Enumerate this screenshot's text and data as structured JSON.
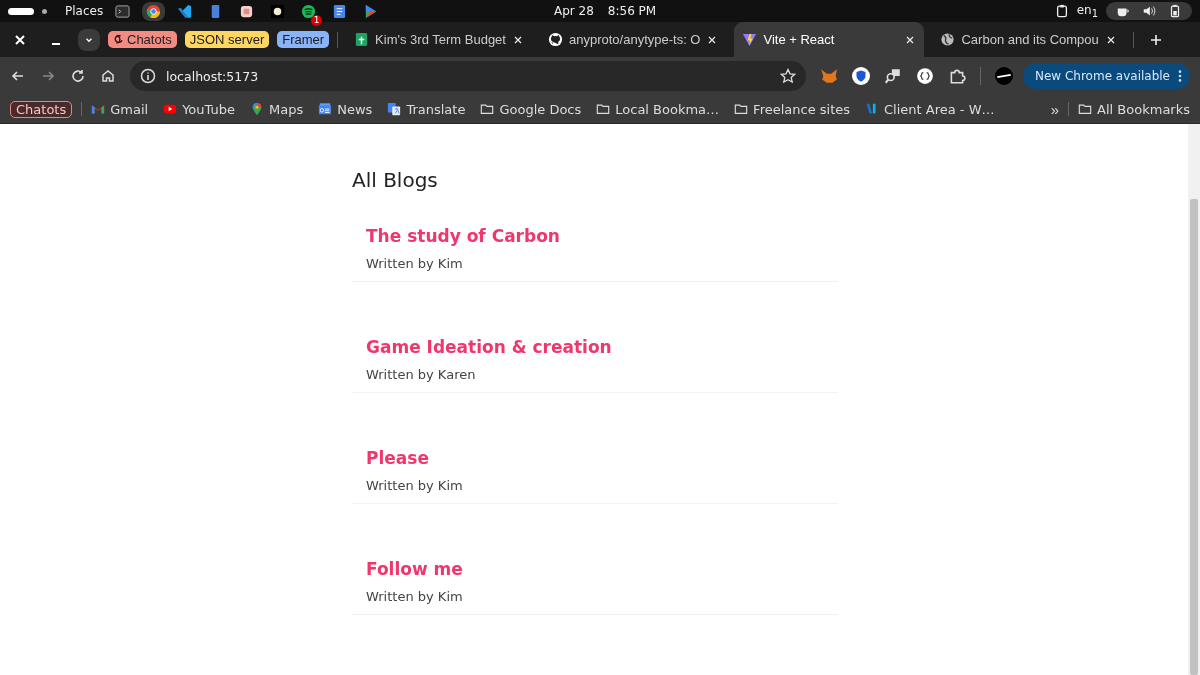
{
  "system_bar": {
    "places": "Places",
    "date": "Apr 28",
    "time": "8:56 PM",
    "keyboard": "en$_{1}$",
    "notification_count": "1"
  },
  "tab_groups": [
    {
      "label": "Chatots",
      "color": "#f28b82",
      "icon": true
    },
    {
      "label": "JSON server",
      "color": "#fdd663",
      "icon": false
    },
    {
      "label": "Framer",
      "color": "#8ab4f8",
      "icon": false
    }
  ],
  "tabs": [
    {
      "title": "Kim's 3rd Term Budget",
      "selected": false,
      "kind": "sheet"
    },
    {
      "title": "anyproto/anytype-ts: O",
      "selected": false,
      "kind": "github"
    },
    {
      "title": "Vite + React",
      "selected": true,
      "kind": "vite"
    },
    {
      "title": "Carbon and its Compou",
      "selected": false,
      "kind": "globe"
    }
  ],
  "address_bar": {
    "url": "localhost:5173"
  },
  "update_button": "New Chrome available",
  "bookmarks": [
    {
      "label": "Chatots",
      "kind": "group"
    },
    {
      "label": "Gmail",
      "kind": "gmail"
    },
    {
      "label": "YouTube",
      "kind": "youtube"
    },
    {
      "label": "Maps",
      "kind": "maps"
    },
    {
      "label": "News",
      "kind": "news"
    },
    {
      "label": "Translate",
      "kind": "translate"
    },
    {
      "label": "Google Docs",
      "kind": "folder"
    },
    {
      "label": "Local Bookma…",
      "kind": "folder"
    },
    {
      "label": "Freelance sites",
      "kind": "folder"
    },
    {
      "label": "Client Area - W…",
      "kind": "site"
    }
  ],
  "bookmarks_more": "»",
  "all_bookmarks": "All Bookmarks",
  "page": {
    "heading": "All Blogs",
    "blogs": [
      {
        "title": "The study of Carbon",
        "author": "Written by Kim"
      },
      {
        "title": "Game Ideation & creation",
        "author": "Written by Karen"
      },
      {
        "title": "Please",
        "author": "Written by Kim"
      },
      {
        "title": "Follow me",
        "author": "Written by Kim"
      }
    ]
  }
}
